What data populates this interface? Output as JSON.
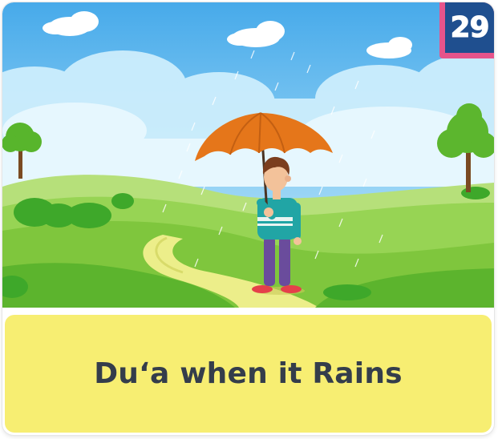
{
  "card": {
    "number": "29",
    "title": "Du‘a when it Rains"
  },
  "colors": {
    "badge_bg": "#1f4f8f",
    "badge_border": "#e6548b",
    "caption_bg": "#f7ee72",
    "title_text": "#343d4b",
    "sky": "#4fb4ee",
    "grass": "#7cc83c",
    "umbrella": "#e5761a"
  },
  "illustration": {
    "subject": "boy-with-umbrella-in-rain"
  }
}
